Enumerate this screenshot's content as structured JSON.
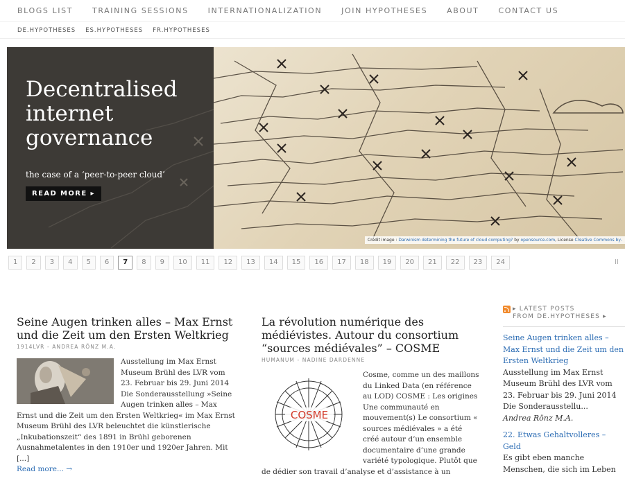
{
  "nav": {
    "items": [
      "BLOGS LIST",
      "TRAINING SESSIONS",
      "INTERNATIONALIZATION",
      "JOIN HYPOTHESES",
      "ABOUT",
      "CONTACT US"
    ]
  },
  "subnav": {
    "items": [
      "DE.HYPOTHESES",
      "ES.HYPOTHESES",
      "FR.HYPOTHESES"
    ]
  },
  "hero": {
    "title": "Decentralised internet governance",
    "subtitle": "the case of a ‘peer-to-peer cloud’",
    "button": "READ MORE",
    "button_icon": "▸",
    "credit_prefix": "Crédit image : ",
    "credit_link1": "Darwinism determining the future of cloud computing?",
    "credit_by": " by ",
    "credit_link2": "opensource.com",
    "credit_license": ", License ",
    "credit_link3": "Creative Commons by-"
  },
  "pager": {
    "pages": [
      "1",
      "2",
      "3",
      "4",
      "5",
      "6",
      "7",
      "8",
      "9",
      "10",
      "11",
      "12",
      "13",
      "14",
      "15",
      "16",
      "17",
      "18",
      "19",
      "20",
      "21",
      "22",
      "23",
      "24"
    ],
    "active": "7",
    "more": "II"
  },
  "posts": [
    {
      "title": "Seine Augen trinken alles – Max Ernst und die Zeit um den Ersten Weltkrieg",
      "meta": "1914LVR - ANDREA RÖNZ M.A.",
      "excerpt": "Ausstellung im Max Ernst Museum Brühl des LVR vom 23. Februar bis 29. Juni 2014 Die Sonderausstellung »Seine Augen trinken alles – Max Ernst und die Zeit um den Ersten Weltkrieg« im Max Ernst Museum Brühl des LVR beleuchtet die künstlerische „Inkubationszeit“ des 1891 in Brühl geborenen Ausnahmetalentes in den 1910er und 1920er Jahren. Mit [...]",
      "readmore": "Read more... →"
    },
    {
      "title": "La révolution numérique des médiévistes. Autour du consortium “sources médiévales” – COSME",
      "meta": "HUMANUM - NADINE DARDENNE",
      "logo_text": "COSME",
      "excerpt": "Cosme, comme un des maillons du Linked Data (en référence au LOD) COSME : Les origines Une communauté en mouvement(s) Le consortium « sources médiévales » a été créé autour d’un ensemble documentaire d’une grande variété typologique. Plutôt que de dédier son travail d’analyse et d’assistance à un"
    }
  ],
  "sidebar": {
    "heading_line1": "LATEST POSTS",
    "heading_line2": "FROM DE.HYPOTHESES",
    "heading_arrow": "▸",
    "entries": [
      {
        "title": "Seine Augen trinken alles – Max Ernst und die Zeit um den Ersten Weltkrieg",
        "text": "Ausstellung im Max Ernst Museum Brühl des LVR vom 23. Februar bis 29. Juni 2014 Die Sonderausstellu...",
        "author": "Andrea Rönz M.A."
      },
      {
        "title": "22. Etwas Gehaltvolleres – Geld",
        "text": "Es gibt eben manche Menschen, die sich im Leben"
      }
    ]
  },
  "colors": {
    "link": "#2a6bb3",
    "hero_dark": "#3d3a36",
    "rss": "#f18a2c"
  }
}
